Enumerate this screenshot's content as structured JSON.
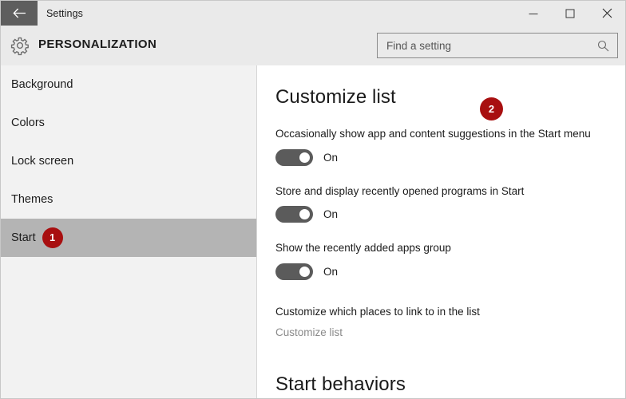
{
  "window": {
    "title": "Settings",
    "back_icon": "back-arrow-icon",
    "minimize_label": "—",
    "maximize_label": "□",
    "close_label": "✕"
  },
  "header": {
    "gear_icon": "gear-icon",
    "title": "PERSONALIZATION",
    "search": {
      "value": "",
      "placeholder": "Find a setting",
      "icon": "search-icon"
    }
  },
  "sidebar": {
    "items": [
      {
        "label": "Background",
        "selected": false,
        "badge": null
      },
      {
        "label": "Colors",
        "selected": false,
        "badge": null
      },
      {
        "label": "Lock screen",
        "selected": false,
        "badge": null
      },
      {
        "label": "Themes",
        "selected": false,
        "badge": null
      },
      {
        "label": "Start",
        "selected": true,
        "badge": "1"
      }
    ]
  },
  "main": {
    "heading": "Customize list",
    "heading_badge": "2",
    "settings": [
      {
        "label": "Occasionally show app and content suggestions in the Start menu",
        "state": "On"
      },
      {
        "label": "Store and display recently opened programs in Start",
        "state": "On"
      },
      {
        "label": "Show the recently added apps group",
        "state": "On"
      }
    ],
    "places_label": "Customize which places to link to in the list",
    "places_link": "Customize list",
    "next_heading": "Start behaviors"
  },
  "colors": {
    "badge_red": "#a80f10",
    "titlebar_bg": "#eaeaea",
    "sidebar_bg": "#f2f2f2",
    "selected_bg": "#b4b4b4",
    "toggle_on": "#5b5b5b",
    "back_btn_bg": "#5e5e5e"
  }
}
